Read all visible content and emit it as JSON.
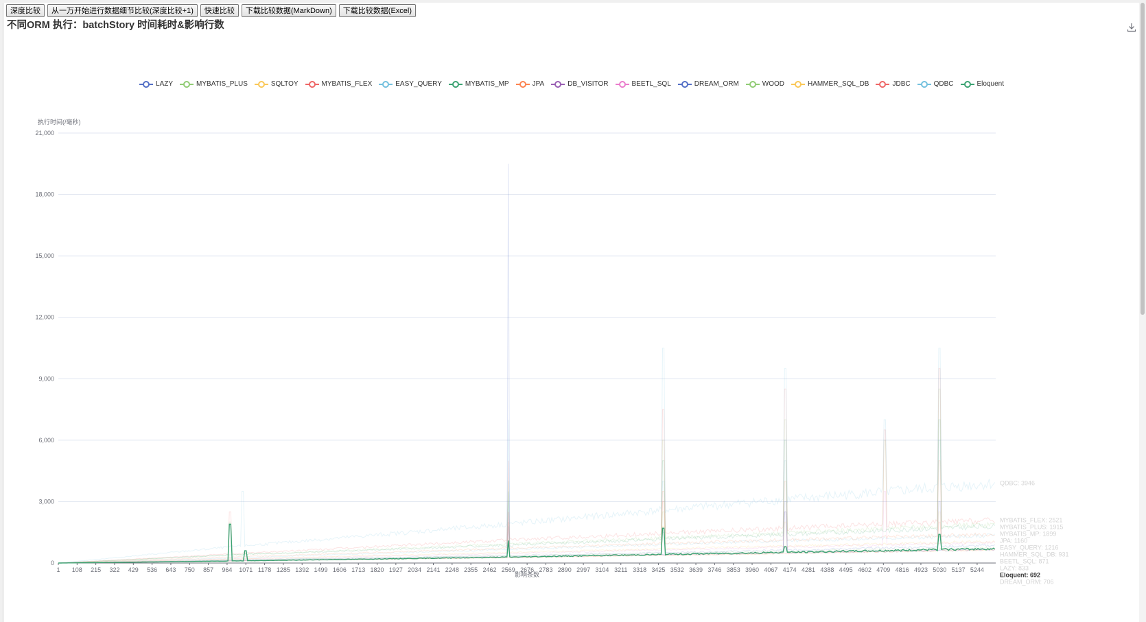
{
  "toolbar": {
    "buttons": [
      "深度比较",
      "从一万开始进行数据细节比较(深度比较+1)",
      "快速比较",
      "下载比较数据(MarkDown)",
      "下载比较数据(Excel)"
    ]
  },
  "icons": {
    "save": "download-icon"
  },
  "colors": {
    "axis": "#6e7079",
    "grid": "#e0e6f1",
    "background": "#ffffff"
  },
  "chart_data": {
    "type": "line",
    "title": "不同ORM 执行：batchStory 时间耗时&影响行数",
    "ylabel": "执行时间(/毫秒)",
    "xlabel": "影响条数",
    "ylim": [
      0,
      21000
    ],
    "yticks": [
      0,
      3000,
      6000,
      9000,
      12000,
      15000,
      18000,
      21000
    ],
    "ytick_labels": [
      "0",
      "3,000",
      "6,000",
      "9,000",
      "12,000",
      "15,000",
      "18,000",
      "21,000"
    ],
    "xlim": [
      1,
      5350
    ],
    "xtick_labels": [
      "1",
      "108",
      "215",
      "322",
      "429",
      "536",
      "643",
      "750",
      "857",
      "964",
      "1071",
      "1178",
      "1285",
      "1392",
      "1499",
      "1606",
      "1713",
      "1820",
      "1927",
      "2034",
      "2141",
      "2248",
      "2355",
      "2462",
      "2569",
      "2676",
      "2783",
      "2890",
      "2997",
      "3104",
      "3211",
      "3318",
      "3425",
      "3532",
      "3639",
      "3746",
      "3853",
      "3960",
      "4067",
      "4174",
      "4281",
      "4388",
      "4495",
      "4602",
      "4709",
      "4816",
      "4923",
      "5030",
      "5137",
      "5244"
    ],
    "grid": true,
    "legend_position": "top",
    "series": [
      {
        "name": "LAZY",
        "color": "#5470c6",
        "faded": true,
        "points": [
          [
            1,
            0
          ],
          [
            1000,
            150
          ],
          [
            2500,
            350
          ],
          [
            4000,
            600
          ],
          [
            5350,
            860
          ]
        ],
        "spikes": [
          [
            2569,
            1800
          ],
          [
            3450,
            1500
          ],
          [
            4150,
            2500
          ],
          [
            5030,
            3000
          ]
        ],
        "end_label": "LAZY: 833"
      },
      {
        "name": "MYBATIS_PLUS",
        "color": "#91cc75",
        "faded": true,
        "points": [
          [
            1,
            0
          ],
          [
            1000,
            400
          ],
          [
            2500,
            900
          ],
          [
            4000,
            1400
          ],
          [
            5350,
            1900
          ]
        ],
        "spikes": [
          [
            980,
            2000
          ],
          [
            2569,
            4000
          ],
          [
            3450,
            6000
          ],
          [
            4150,
            7000
          ],
          [
            4720,
            6000
          ],
          [
            5030,
            8500
          ]
        ],
        "end_label": "MYBATIS_PLUS: 1915"
      },
      {
        "name": "SQLTOY",
        "color": "#fac858",
        "faded": true,
        "points": [
          [
            1,
            0
          ],
          [
            1000,
            100
          ],
          [
            2500,
            250
          ],
          [
            4000,
            450
          ],
          [
            5350,
            650
          ]
        ],
        "spikes": [
          [
            2569,
            1200
          ],
          [
            3450,
            1800
          ],
          [
            4150,
            2000
          ],
          [
            5030,
            2500
          ]
        ],
        "end_label": ""
      },
      {
        "name": "MYBATIS_FLEX",
        "color": "#ee6666",
        "faded": true,
        "points": [
          [
            1,
            0
          ],
          [
            1000,
            450
          ],
          [
            2500,
            1100
          ],
          [
            4000,
            1650
          ],
          [
            5350,
            2100
          ]
        ],
        "spikes": [
          [
            980,
            2500
          ],
          [
            2569,
            5000
          ],
          [
            3450,
            7500
          ],
          [
            4150,
            8500
          ],
          [
            4720,
            6500
          ],
          [
            5030,
            9500
          ]
        ],
        "end_label": "MYBATIS_FLEX: 2521"
      },
      {
        "name": "EASY_QUERY",
        "color": "#73c0de",
        "faded": true,
        "points": [
          [
            1,
            0
          ],
          [
            1000,
            250
          ],
          [
            2500,
            650
          ],
          [
            4000,
            1050
          ],
          [
            5350,
            1350
          ]
        ],
        "spikes": [
          [
            2569,
            3000
          ],
          [
            3450,
            4000
          ],
          [
            4150,
            5000
          ],
          [
            5030,
            6000
          ]
        ],
        "end_label": "EASY_QUERY: 1216"
      },
      {
        "name": "MYBATIS_MP",
        "color": "#3ba272",
        "faded": true,
        "points": [
          [
            1,
            0
          ],
          [
            1000,
            400
          ],
          [
            2500,
            850
          ],
          [
            4000,
            1350
          ],
          [
            5350,
            1800
          ]
        ],
        "spikes": [
          [
            2569,
            3500
          ],
          [
            3450,
            5000
          ],
          [
            4150,
            6000
          ],
          [
            5030,
            7000
          ]
        ],
        "end_label": "MYBATIS_MP: 1899"
      },
      {
        "name": "JPA",
        "color": "#fc8452",
        "faded": true,
        "points": [
          [
            1,
            0
          ],
          [
            1000,
            300
          ],
          [
            2500,
            700
          ],
          [
            4000,
            1100
          ],
          [
            5350,
            1400
          ]
        ],
        "spikes": [
          [
            2569,
            2500
          ],
          [
            3450,
            3500
          ],
          [
            4150,
            4000
          ],
          [
            5030,
            5000
          ]
        ],
        "end_label": "JPA: 1160"
      },
      {
        "name": "DB_VISITOR",
        "color": "#9a60b4",
        "faded": true,
        "points": [
          [
            1,
            0
          ],
          [
            1000,
            120
          ],
          [
            2500,
            300
          ],
          [
            4000,
            500
          ],
          [
            5350,
            700
          ]
        ],
        "spikes": [
          [
            2569,
            2000
          ],
          [
            4150,
            2500
          ]
        ],
        "end_label": ""
      },
      {
        "name": "BEETL_SQL",
        "color": "#ea7ccc",
        "faded": true,
        "points": [
          [
            1,
            0
          ],
          [
            1000,
            200
          ],
          [
            2500,
            450
          ],
          [
            4000,
            750
          ],
          [
            5350,
            1000
          ]
        ],
        "spikes": [
          [
            2569,
            2500
          ],
          [
            3450,
            3000
          ],
          [
            4720,
            3500
          ]
        ],
        "end_label": "BEETL_SQL: 871"
      },
      {
        "name": "DREAM_ORM",
        "color": "#5470c6",
        "faded": true,
        "points": [
          [
            1,
            0
          ],
          [
            1000,
            110
          ],
          [
            2500,
            280
          ],
          [
            4000,
            470
          ],
          [
            5350,
            650
          ]
        ],
        "spikes": [
          [
            2569,
            19500
          ],
          [
            4150,
            3000
          ]
        ],
        "end_label": "DREAM_ORM: 706"
      },
      {
        "name": "WOOD",
        "color": "#91cc75",
        "faded": true,
        "points": [
          [
            1,
            0
          ],
          [
            1000,
            150
          ],
          [
            2500,
            350
          ],
          [
            4000,
            550
          ],
          [
            5350,
            750
          ]
        ],
        "spikes": [
          [
            3450,
            2500
          ]
        ],
        "end_label": ""
      },
      {
        "name": "HAMMER_SQL_DB",
        "color": "#fac858",
        "faded": true,
        "points": [
          [
            1,
            0
          ],
          [
            1000,
            200
          ],
          [
            2500,
            500
          ],
          [
            4000,
            800
          ],
          [
            5350,
            1050
          ]
        ],
        "spikes": [
          [
            2569,
            2000
          ],
          [
            3450,
            3000
          ]
        ],
        "end_label": "HAMMER_SQL_DB: 931"
      },
      {
        "name": "JDBC",
        "color": "#ee6666",
        "faded": true,
        "points": [
          [
            1,
            0
          ],
          [
            1000,
            100
          ],
          [
            2500,
            260
          ],
          [
            4000,
            450
          ],
          [
            5350,
            650
          ]
        ],
        "spikes": [
          [
            5030,
            2000
          ]
        ],
        "end_label": ""
      },
      {
        "name": "QDBC",
        "color": "#73c0de",
        "faded": true,
        "points": [
          [
            1,
            0
          ],
          [
            1000,
            800
          ],
          [
            2500,
            1850
          ],
          [
            4000,
            3000
          ],
          [
            5350,
            3900
          ]
        ],
        "spikes": [
          [
            1050,
            3500
          ],
          [
            2569,
            7000
          ],
          [
            3450,
            10500
          ],
          [
            4150,
            9500
          ],
          [
            4720,
            7000
          ],
          [
            5030,
            10500
          ]
        ],
        "end_label": "QDBC: 3946"
      },
      {
        "name": "Eloquent",
        "color": "#3ba272",
        "faded": false,
        "points": [
          [
            1,
            0
          ],
          [
            1000,
            100
          ],
          [
            2500,
            280
          ],
          [
            4000,
            500
          ],
          [
            5350,
            700
          ]
        ],
        "spikes": [
          [
            980,
            1900
          ],
          [
            1071,
            600
          ],
          [
            2569,
            1100
          ],
          [
            3450,
            1700
          ],
          [
            4150,
            800
          ],
          [
            5030,
            1400
          ]
        ],
        "end_label": "Eloquent: 692"
      }
    ]
  }
}
